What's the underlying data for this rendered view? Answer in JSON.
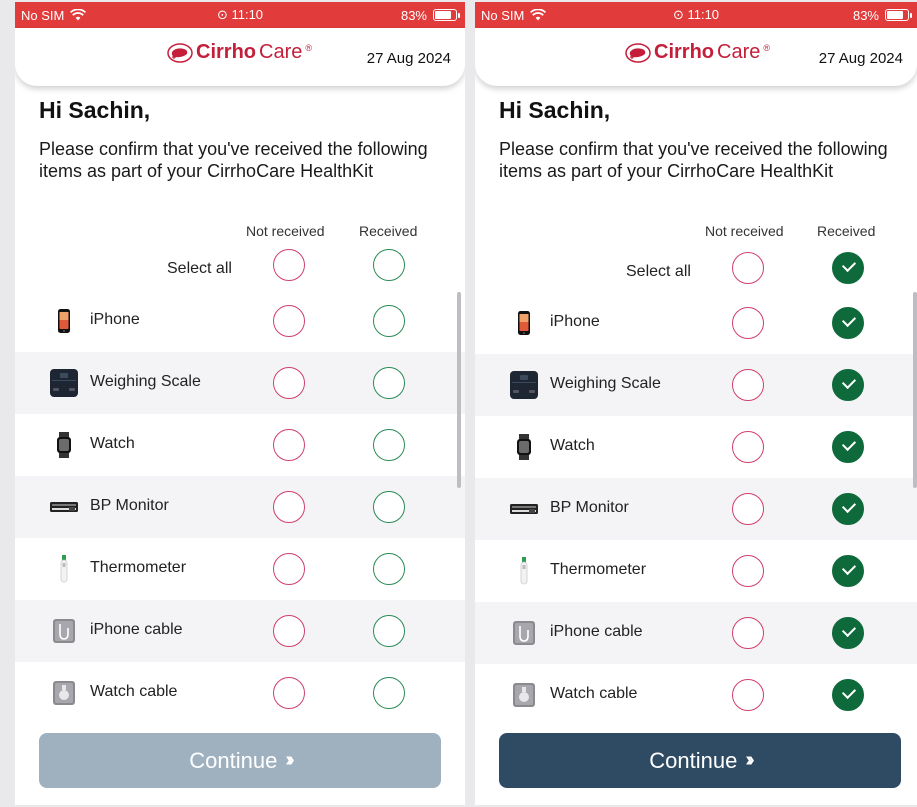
{
  "status": {
    "carrier": "No SIM",
    "time": "11:10",
    "battery": "83%",
    "battery_level": 0.83
  },
  "brand": {
    "part1": "Cirrho",
    "part2": "Care",
    "mark": "®",
    "color": "#c41e3a"
  },
  "header": {
    "date": "27 Aug 2024"
  },
  "greeting": "Hi Sachin,",
  "intro": "Please confirm that you've received the following items as part of your CirrhoCare HealthKit",
  "columns": {
    "not_received": "Not received",
    "received": "Received"
  },
  "select_all_label": "Select all",
  "items": [
    {
      "label": "iPhone",
      "icon": "iphone-icon"
    },
    {
      "label": "Weighing Scale",
      "icon": "weighing-scale-icon"
    },
    {
      "label": "Watch",
      "icon": "watch-icon"
    },
    {
      "label": "BP Monitor",
      "icon": "bp-monitor-icon"
    },
    {
      "label": "Thermometer",
      "icon": "thermometer-icon"
    },
    {
      "label": "iPhone cable",
      "icon": "iphone-cable-icon"
    },
    {
      "label": "Watch cable",
      "icon": "watch-cable-icon"
    }
  ],
  "screens": [
    {
      "state": "nothing-selected",
      "continue_label": "Continue",
      "continue_enabled": false
    },
    {
      "state": "all-received",
      "continue_label": "Continue",
      "continue_enabled": true
    }
  ],
  "colors": {
    "status_bar": "#e13b3b",
    "not_received_ring": "#d0406a",
    "received_ring": "#2b8a55",
    "received_checked": "#0e6a3a",
    "continue_disabled": "#9fb1bf",
    "continue_enabled": "#2f4b64"
  }
}
